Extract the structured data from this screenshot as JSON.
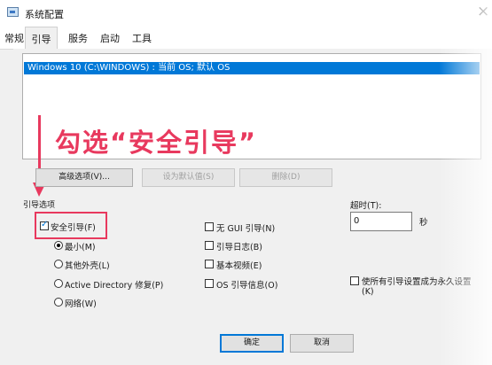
{
  "window": {
    "title": "系统配置",
    "close_glyph": "×"
  },
  "tabs": [
    "常规",
    "引导",
    "服务",
    "启动",
    "工具"
  ],
  "boot_list": {
    "selected_entry": "Windows 10 (C:\\WINDOWS) : 当前 OS; 默认 OS"
  },
  "annotation": {
    "text": "勾选“安全引导”"
  },
  "buttons": {
    "advanced": "高级选项(V)...",
    "set_default": "设为默认值(S)",
    "delete": "删除(D)",
    "ok": "确定",
    "cancel": "取消"
  },
  "boot_options": {
    "group_label": "引导选项",
    "safe_boot": {
      "label": "安全引导(F)",
      "checked": true
    },
    "radios": [
      {
        "label": "最小(M)",
        "checked": true
      },
      {
        "label": "其他外壳(L)",
        "checked": false
      },
      {
        "label": "Active Directory 修复(P)",
        "checked": false
      },
      {
        "label": "网络(W)",
        "checked": false
      }
    ],
    "checkboxes": [
      {
        "label": "无 GUI 引导(N)",
        "checked": false
      },
      {
        "label": "引导日志(B)",
        "checked": false
      },
      {
        "label": "基本视频(E)",
        "checked": false
      },
      {
        "label": "OS 引导信息(O)",
        "checked": false
      }
    ]
  },
  "timeout": {
    "label": "超时(T):",
    "value": "0",
    "unit": "秒"
  },
  "permanent": {
    "line1": "使所有引导设置成为永久设置",
    "line2": "(K)",
    "checked": false
  },
  "colors": {
    "accent": "#0078d7",
    "annotation": "#e8395e"
  }
}
